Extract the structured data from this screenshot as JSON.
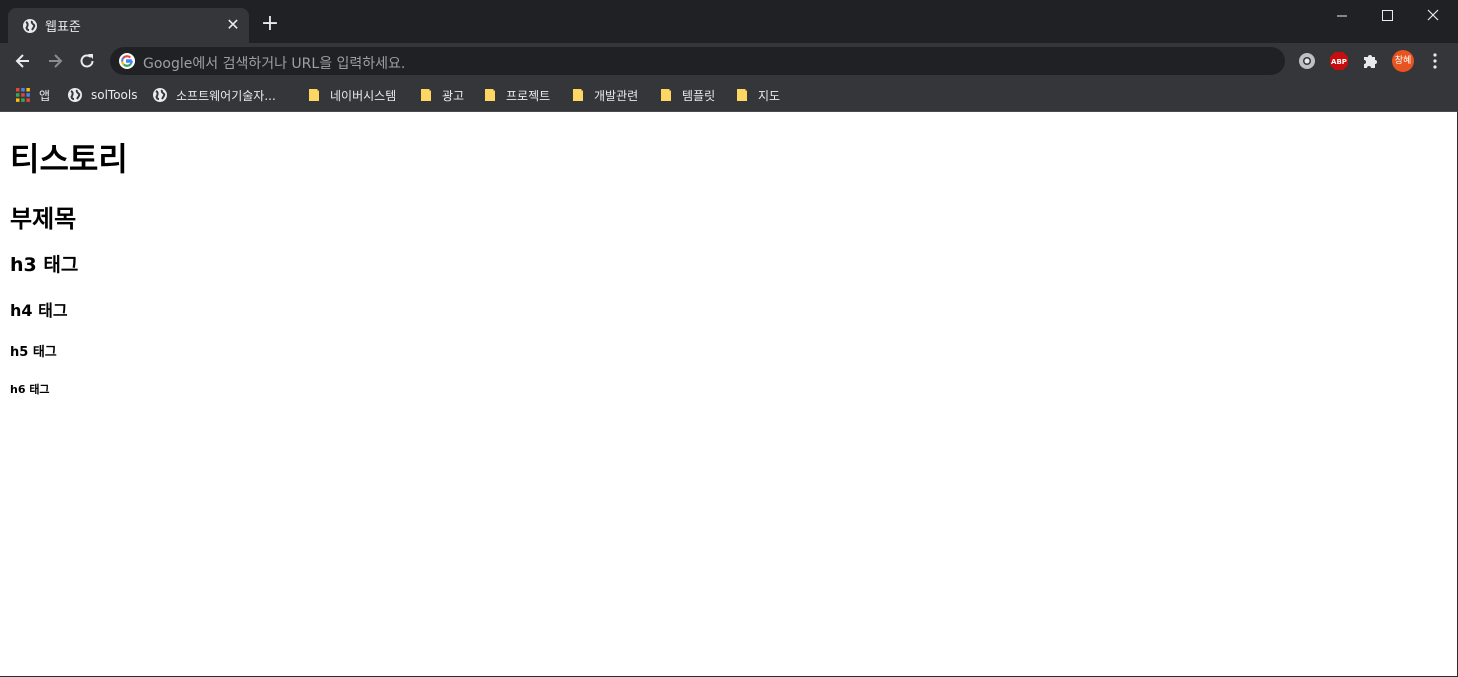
{
  "browser": {
    "tab": {
      "title": "웹표준",
      "icon": "globe-icon"
    },
    "window_controls": [
      "minimize",
      "maximize",
      "close"
    ],
    "omnibox": {
      "placeholder": "Google에서 검색하거나 URL을 입력하세요."
    },
    "extensions": [
      {
        "name": "ring-extension-icon"
      },
      {
        "name": "adblock-plus-icon",
        "label": "ABP",
        "color": "#c70d0d"
      },
      {
        "name": "puzzle-extensions-icon"
      }
    ],
    "profile": {
      "initials": "창혜",
      "color": "#e8541f"
    }
  },
  "bookmarks": [
    {
      "label": "앱",
      "icon": "apps-grid-icon"
    },
    {
      "label": "solTools",
      "icon": "globe-icon"
    },
    {
      "label": "소프트웨어기술자...",
      "icon": "globe-icon"
    },
    {
      "label": "네이버시스템",
      "icon": "folder-icon"
    },
    {
      "label": "광고",
      "icon": "folder-icon"
    },
    {
      "label": "프로젝트",
      "icon": "folder-icon"
    },
    {
      "label": "개발관련",
      "icon": "folder-icon"
    },
    {
      "label": "템플릿",
      "icon": "folder-icon"
    },
    {
      "label": "지도",
      "icon": "folder-icon"
    }
  ],
  "page": {
    "h1": "티스토리",
    "h2": "부제목",
    "h3": "h3 태그",
    "h4": "h4 태그",
    "h5": "h5 태그",
    "h6": "h6 태그"
  },
  "colors": {
    "titlebar": "#202124",
    "toolbar": "#35363a",
    "text_light": "#e8eaed"
  }
}
